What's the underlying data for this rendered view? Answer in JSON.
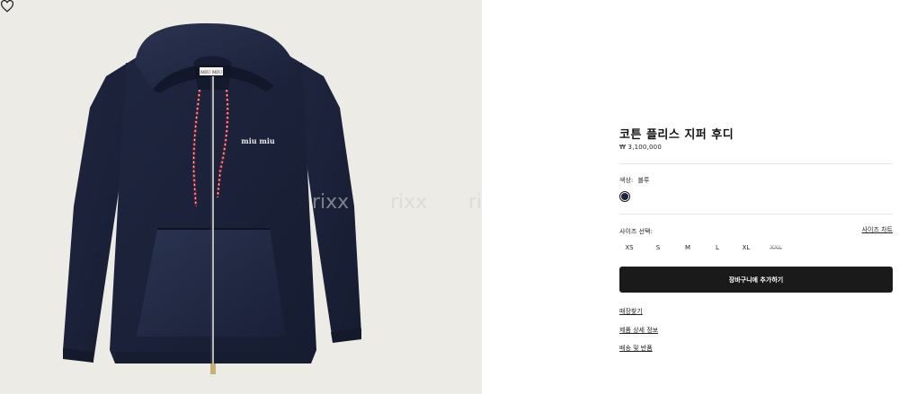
{
  "product": {
    "name": "코튼 플리스 지퍼 후디",
    "price": "₩ 3,100,000",
    "image_alt": "navy zip hoodie product image",
    "brand_logo": "miu miu",
    "label_text": "MIU MIU",
    "watermark": "rixx"
  },
  "color": {
    "label": "색상:",
    "value": "블루",
    "swatch_color": "#1c2540"
  },
  "sizes": {
    "label": "사이즈 선택:",
    "guide_link": "사이즈 차트",
    "options": [
      "XS",
      "S",
      "M",
      "L",
      "XL",
      "XXL"
    ],
    "unavailable": [
      "XXL"
    ]
  },
  "actions": {
    "add_to_cart": "장바구니에 추가하기"
  },
  "links": [
    "매장찾기",
    "제품 상세 정보",
    "배송 및 반품"
  ],
  "icons": {
    "wishlist": "heart-icon"
  }
}
